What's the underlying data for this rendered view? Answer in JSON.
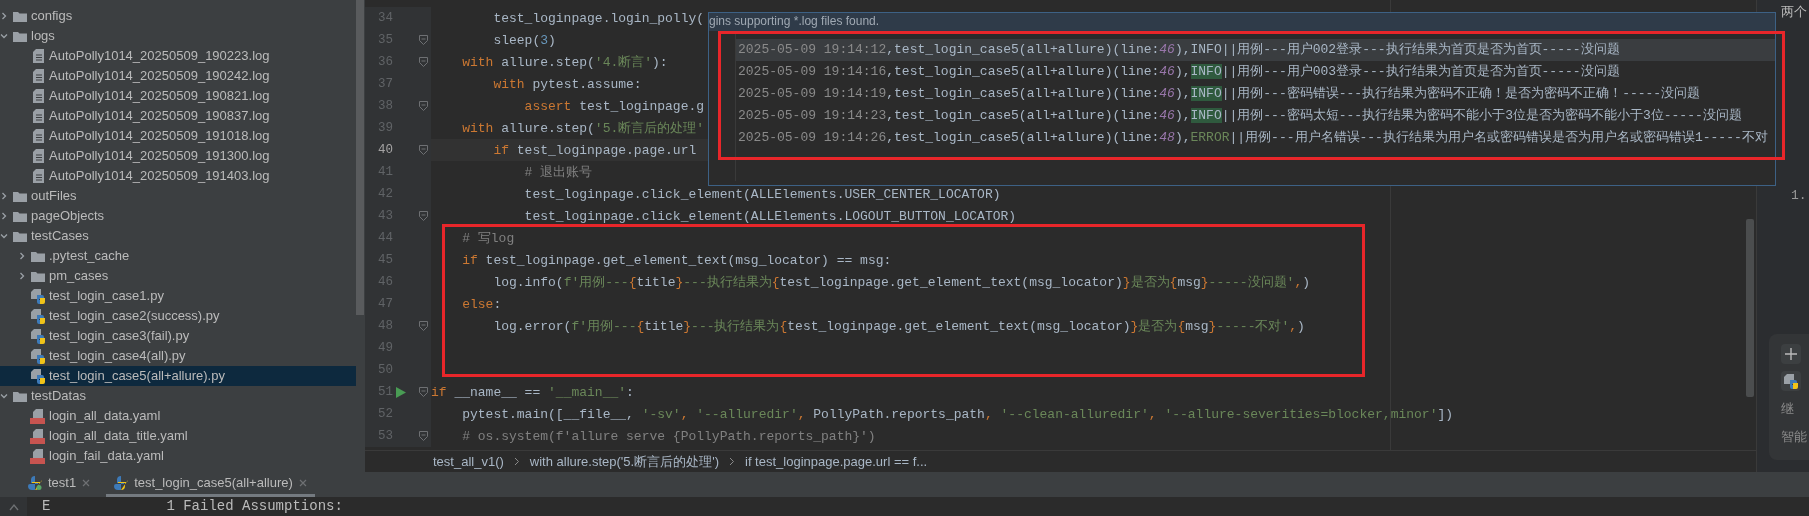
{
  "project_tree": [
    {
      "label": "configs",
      "kind": "folder",
      "expanded": false,
      "selected": false
    },
    {
      "label": "logs",
      "kind": "folder",
      "expanded": true,
      "selected": false,
      "children": [
        {
          "label": "AutoPolly1014_20250509_190223.log",
          "kind": "log",
          "selected": false
        },
        {
          "label": "AutoPolly1014_20250509_190242.log",
          "kind": "log",
          "selected": false
        },
        {
          "label": "AutoPolly1014_20250509_190821.log",
          "kind": "log",
          "selected": false
        },
        {
          "label": "AutoPolly1014_20250509_190837.log",
          "kind": "log",
          "selected": false
        },
        {
          "label": "AutoPolly1014_20250509_191018.log",
          "kind": "log",
          "selected": false
        },
        {
          "label": "AutoPolly1014_20250509_191300.log",
          "kind": "log",
          "selected": false
        },
        {
          "label": "AutoPolly1014_20250509_191403.log",
          "kind": "log",
          "selected": false
        }
      ]
    },
    {
      "label": "outFiles",
      "kind": "folder",
      "expanded": false,
      "selected": false
    },
    {
      "label": "pageObjects",
      "kind": "folder",
      "expanded": false,
      "selected": false
    },
    {
      "label": "testCases",
      "kind": "folder",
      "expanded": true,
      "selected": false,
      "children": [
        {
          "label": ".pytest_cache",
          "kind": "folder",
          "expanded": false,
          "selected": false
        },
        {
          "label": "pm_cases",
          "kind": "folder",
          "expanded": false,
          "selected": false
        },
        {
          "label": "test_login_case1.py",
          "kind": "python",
          "selected": false
        },
        {
          "label": "test_login_case2(success).py",
          "kind": "python",
          "selected": false
        },
        {
          "label": "test_login_case3(fail).py",
          "kind": "python",
          "selected": false
        },
        {
          "label": "test_login_case4(all).py",
          "kind": "python",
          "selected": false
        },
        {
          "label": "test_login_case5(all+allure).py",
          "kind": "python",
          "selected": true
        }
      ]
    },
    {
      "label": "testDatas",
      "kind": "folder",
      "expanded": true,
      "selected": false,
      "children": [
        {
          "label": "login_all_data.yaml",
          "kind": "yaml",
          "selected": false
        },
        {
          "label": "login_all_data_title.yaml",
          "kind": "yaml",
          "selected": false
        },
        {
          "label": "login_fail_data.yaml",
          "kind": "yaml",
          "selected": false
        }
      ]
    }
  ],
  "code_lines": [
    {
      "number": "34",
      "current": false,
      "fold": false,
      "run": false,
      "tokens": [
        {
          "t": "        test_loginpage.login_polly(",
          "kind": "plain"
        }
      ]
    },
    {
      "number": "35",
      "current": false,
      "fold": true,
      "run": false,
      "tokens": [
        {
          "t": "        sleep(",
          "kind": "plain"
        },
        {
          "t": "3",
          "kind": "num"
        },
        {
          "t": ")",
          "kind": "plain"
        }
      ]
    },
    {
      "number": "36",
      "current": false,
      "fold": true,
      "run": false,
      "tokens": [
        {
          "t": "    with",
          "kind": "kw"
        },
        {
          "t": " allure.step(",
          "kind": "plain"
        },
        {
          "t": "'4.断言'",
          "kind": "str"
        },
        {
          "t": "):",
          "kind": "plain"
        }
      ]
    },
    {
      "number": "37",
      "current": false,
      "fold": false,
      "run": false,
      "tokens": [
        {
          "t": "        with",
          "kind": "kw"
        },
        {
          "t": " pytest.assume:",
          "kind": "plain"
        }
      ]
    },
    {
      "number": "38",
      "current": false,
      "fold": true,
      "run": false,
      "tokens": [
        {
          "t": "            assert",
          "kind": "kw"
        },
        {
          "t": " test_loginpage.g",
          "kind": "plain"
        }
      ]
    },
    {
      "number": "39",
      "current": false,
      "fold": false,
      "run": false,
      "tokens": [
        {
          "t": "    with",
          "kind": "kw"
        },
        {
          "t": " allure.step(",
          "kind": "plain"
        },
        {
          "t": "'5.断言后的处理'",
          "kind": "str"
        }
      ]
    },
    {
      "number": "40",
      "current": true,
      "fold": true,
      "run": false,
      "tokens": [
        {
          "t": "        if",
          "kind": "kw"
        },
        {
          "t": " test_loginpage.page.url",
          "kind": "plain"
        }
      ]
    },
    {
      "number": "41",
      "current": false,
      "fold": false,
      "run": false,
      "tokens": [
        {
          "t": "            # 退出账号",
          "kind": "cm"
        }
      ]
    },
    {
      "number": "42",
      "current": false,
      "fold": false,
      "run": false,
      "tokens": [
        {
          "t": "            test_loginpage.click_element(ALLElements.USER_CENTER_LOCATOR)",
          "kind": "plain"
        }
      ]
    },
    {
      "number": "43",
      "current": false,
      "fold": true,
      "run": false,
      "tokens": [
        {
          "t": "            test_loginpage.click_element(ALLElements.LOGOUT_BUTTON_LOCATOR)",
          "kind": "plain"
        }
      ]
    },
    {
      "number": "44",
      "current": false,
      "fold": false,
      "run": false,
      "tokens": [
        {
          "t": "    # 写log",
          "kind": "cm"
        }
      ]
    },
    {
      "number": "45",
      "current": false,
      "fold": false,
      "run": false,
      "tokens": [
        {
          "t": "    if",
          "kind": "kw"
        },
        {
          "t": " test_loginpage.get_element_text(msg_locator) == msg:",
          "kind": "plain"
        }
      ]
    },
    {
      "number": "46",
      "current": false,
      "fold": false,
      "run": false,
      "tokens": [
        {
          "t": "        log.info(",
          "kind": "plain"
        },
        {
          "t": "f'用例---",
          "kind": "str"
        },
        {
          "t": "{",
          "kind": "kw"
        },
        {
          "t": "title",
          "kind": "plain"
        },
        {
          "t": "}",
          "kind": "kw"
        },
        {
          "t": "---执行结果为",
          "kind": "str"
        },
        {
          "t": "{",
          "kind": "kw"
        },
        {
          "t": "test_loginpage.get_element_text(msg_locator)",
          "kind": "plain"
        },
        {
          "t": "}",
          "kind": "kw"
        },
        {
          "t": "是否为",
          "kind": "str"
        },
        {
          "t": "{",
          "kind": "kw"
        },
        {
          "t": "msg",
          "kind": "plain"
        },
        {
          "t": "}",
          "kind": "kw"
        },
        {
          "t": "-----没问题'",
          "kind": "str"
        },
        {
          "t": ",",
          "kind": "kw"
        },
        {
          "t": ")",
          "kind": "plain"
        }
      ]
    },
    {
      "number": "47",
      "current": false,
      "fold": false,
      "run": false,
      "tokens": [
        {
          "t": "    else",
          "kind": "kw"
        },
        {
          "t": ":",
          "kind": "plain"
        }
      ]
    },
    {
      "number": "48",
      "current": false,
      "fold": true,
      "run": false,
      "tokens": [
        {
          "t": "        log.error(",
          "kind": "plain"
        },
        {
          "t": "f'用例---",
          "kind": "str"
        },
        {
          "t": "{",
          "kind": "kw"
        },
        {
          "t": "title",
          "kind": "plain"
        },
        {
          "t": "}",
          "kind": "kw"
        },
        {
          "t": "---执行结果为",
          "kind": "str"
        },
        {
          "t": "{",
          "kind": "kw"
        },
        {
          "t": "test_loginpage.get_element_text(msg_locator)",
          "kind": "plain"
        },
        {
          "t": "}",
          "kind": "kw"
        },
        {
          "t": "是否为",
          "kind": "str"
        },
        {
          "t": "{",
          "kind": "kw"
        },
        {
          "t": "msg",
          "kind": "plain"
        },
        {
          "t": "}",
          "kind": "kw"
        },
        {
          "t": "-----不对'",
          "kind": "str"
        },
        {
          "t": ",",
          "kind": "kw"
        },
        {
          "t": ")",
          "kind": "plain"
        }
      ]
    },
    {
      "number": "49",
      "current": false,
      "fold": false,
      "run": false
    },
    {
      "number": "50",
      "current": false,
      "fold": false,
      "run": false
    },
    {
      "number": "51",
      "current": false,
      "fold": true,
      "run": true,
      "tokens": [
        {
          "t": "if",
          "kind": "kw"
        },
        {
          "t": " __name__ == ",
          "kind": "plain"
        },
        {
          "t": "'__main__'",
          "kind": "str"
        },
        {
          "t": ":",
          "kind": "plain"
        }
      ]
    },
    {
      "number": "52",
      "current": false,
      "fold": false,
      "run": false,
      "tokens": [
        {
          "t": "    pytest.main([__file__, ",
          "kind": "plain"
        },
        {
          "t": "'-sv'",
          "kind": "str"
        },
        {
          "t": ", ",
          "kind": "kw"
        },
        {
          "t": "'--alluredir'",
          "kind": "str"
        },
        {
          "t": ", ",
          "kind": "kw"
        },
        {
          "t": "PollyPath.reports_path",
          "kind": "plain"
        },
        {
          "t": ", ",
          "kind": "kw"
        },
        {
          "t": "'--clean-alluredir'",
          "kind": "str"
        },
        {
          "t": ", ",
          "kind": "kw"
        },
        {
          "t": "'--allure-severities=blocker,minor'",
          "kind": "str"
        },
        {
          "t": "])",
          "kind": "plain"
        }
      ]
    },
    {
      "number": "53",
      "current": false,
      "fold": true,
      "run": false,
      "tokens": [
        {
          "t": "    # os.system(f'allure serve {PollyPath.reports_path}')",
          "kind": "cm"
        }
      ]
    }
  ],
  "breadcrumbs": [
    "test_all_v1()",
    "with allure.step('5.断言后的处理')",
    "if test_loginpage.page.url == f..."
  ],
  "log_popup": {
    "header": "gins supporting *.log files found.",
    "entries": [
      {
        "time": "2025-05-09 19:14:12",
        "body": ",test_login_case5(all+allure)(line:",
        "line_no": "46",
        "close": "),",
        "level": "INFO",
        "kind": "info",
        "level_highlighted": false,
        "selected": true,
        "message": "||用例---用户002登录---执行结果为首页是否为首页-----没问题"
      },
      {
        "time": "2025-05-09 19:14:16",
        "body": ",test_login_case5(all+allure)(line:",
        "line_no": "46",
        "close": "),",
        "level": "INFO",
        "kind": "info",
        "level_highlighted": true,
        "selected": false,
        "message": "||用例---用户003登录---执行结果为首页是否为首页-----没问题"
      },
      {
        "time": "2025-05-09 19:14:19",
        "body": ",test_login_case5(all+allure)(line:",
        "line_no": "46",
        "close": "),",
        "level": "INFO",
        "kind": "info",
        "level_highlighted": true,
        "selected": false,
        "message": "||用例---密码错误---执行结果为密码不正确！是否为密码不正确！-----没问题"
      },
      {
        "time": "2025-05-09 19:14:23",
        "body": ",test_login_case5(all+allure)(line:",
        "line_no": "46",
        "close": "),",
        "level": "INFO",
        "kind": "info",
        "level_highlighted": true,
        "selected": false,
        "message": "||用例---密码太短---执行结果为密码不能小于3位是否为密码不能小于3位-----没问题"
      },
      {
        "time": "2025-05-09 19:14:26",
        "body": ",test_login_case5(all+allure)(line:",
        "line_no": "48",
        "close": "),",
        "level": "ERROR",
        "kind": "error",
        "level_highlighted": false,
        "selected": false,
        "message": "||用例---用户名错误---执行结果为用户名或密码错误是否为用户名或密码错误1-----不对"
      }
    ]
  },
  "annotations": [
    {
      "kind": "frame"
    },
    {
      "kind": "frame"
    }
  ],
  "right_panel": {
    "top_text": "两个",
    "list_marker": "1.",
    "labels": [
      "继",
      "智能"
    ]
  },
  "run_tabs": [
    {
      "label": "test1",
      "selected": false,
      "running": true
    },
    {
      "label": "test_login_case5(all+allure)",
      "selected": true,
      "running": false
    }
  ],
  "console": {
    "marker": "E",
    "text": "1 Failed Assumptions:"
  }
}
